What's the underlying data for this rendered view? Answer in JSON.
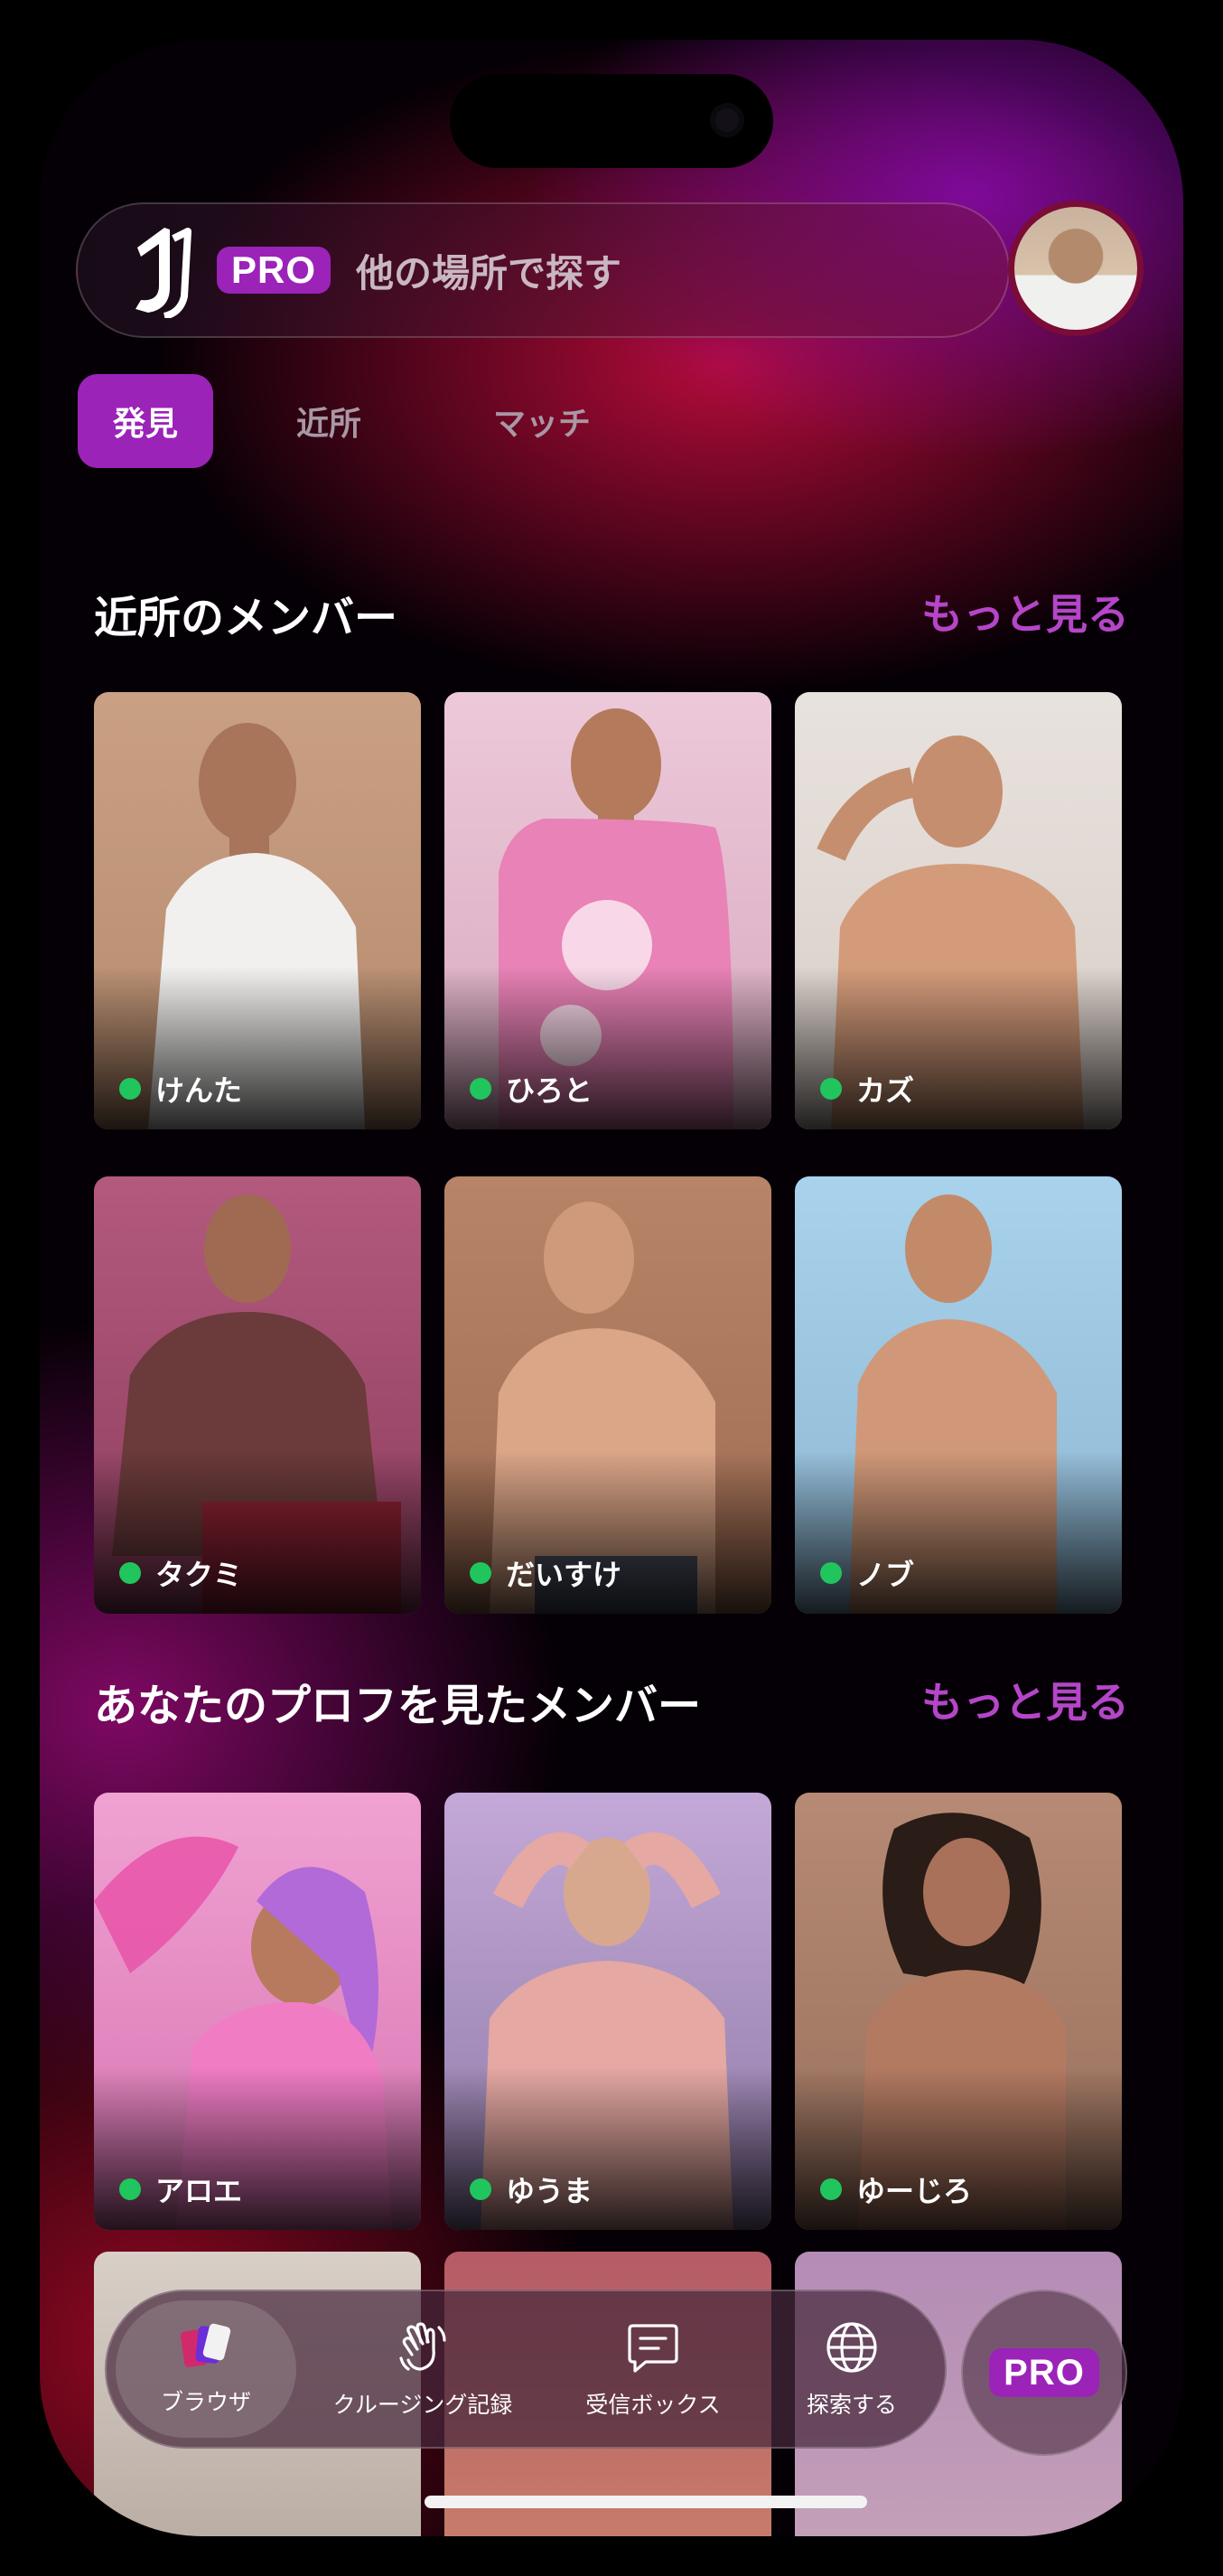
{
  "search": {
    "pro_badge": "PRO",
    "placeholder": "他の場所で探す"
  },
  "tabs": [
    {
      "label": "発見",
      "active": true
    },
    {
      "label": "近所",
      "active": false
    },
    {
      "label": "マッチ",
      "active": false
    }
  ],
  "sections": [
    {
      "title": "近所のメンバー",
      "more": "もっと見る",
      "members": [
        {
          "name": "けんた",
          "online": true
        },
        {
          "name": "ひろと",
          "online": true
        },
        {
          "name": "カズ",
          "online": true
        },
        {
          "name": "タクミ",
          "online": true
        },
        {
          "name": "だいすけ",
          "online": true
        },
        {
          "name": "ノブ",
          "online": true
        }
      ]
    },
    {
      "title": "あなたのプロフを見たメンバー",
      "more": "もっと見る",
      "members": [
        {
          "name": "アロエ",
          "online": true
        },
        {
          "name": "ゆうま",
          "online": true
        },
        {
          "name": "ゆーじろ",
          "online": true
        }
      ]
    }
  ],
  "bottom_nav": {
    "items": [
      {
        "label": "ブラウザ",
        "icon": "cards-icon",
        "active": true
      },
      {
        "label": "クルージング記録",
        "icon": "wave-hand-icon",
        "active": false
      },
      {
        "label": "受信ボックス",
        "icon": "message-icon",
        "active": false
      },
      {
        "label": "探索する",
        "icon": "globe-icon",
        "active": false
      }
    ],
    "pro_label": "PRO"
  },
  "colors": {
    "accent": "#9b23b8",
    "more_link": "#b545c9",
    "online": "#21c55d"
  }
}
